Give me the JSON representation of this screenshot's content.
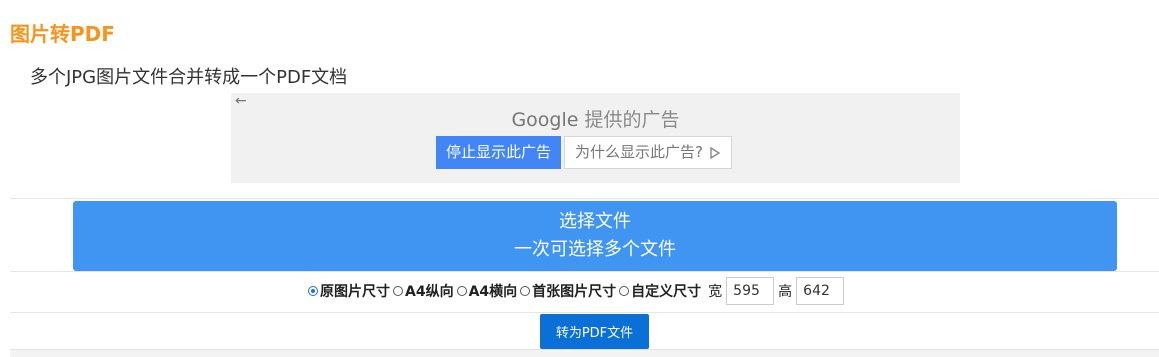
{
  "header": {
    "title": "图片转PDF",
    "subtitle": "多个JPG图片文件合并转成一个PDF文档"
  },
  "ad": {
    "back_icon": "arrow-left-icon",
    "brand": "Google",
    "provided_by": "提供的广告",
    "stop_label": "停止显示此广告",
    "why_label": "为什么显示此广告?",
    "why_icon": "adchoices-play-icon"
  },
  "upload": {
    "line1": "选择文件",
    "line2": "一次可选择多个文件"
  },
  "options": {
    "sizes": [
      {
        "label": "原图片尺寸",
        "checked": true
      },
      {
        "label": "A4纵向",
        "checked": false
      },
      {
        "label": "A4横向",
        "checked": false
      },
      {
        "label": "首张图片尺寸",
        "checked": false
      },
      {
        "label": "自定义尺寸",
        "checked": false
      }
    ],
    "width_label": "宽",
    "width_value": "595",
    "height_label": "高",
    "height_value": "642"
  },
  "actions": {
    "convert_label": "转为PDF文件"
  },
  "colors": {
    "title": "#f7941d",
    "upload_bg": "#4095f2",
    "convert_bg": "#0a6fd6",
    "ad_stop_bg": "#4285f4"
  }
}
